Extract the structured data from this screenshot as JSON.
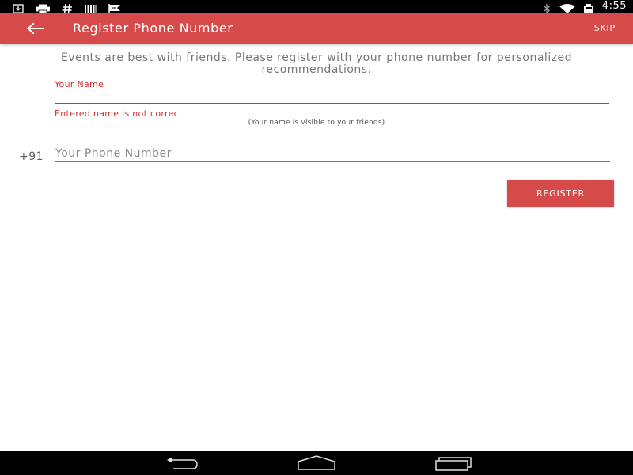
{
  "status_bar": {
    "time": "4:55",
    "left_icons": [
      "download-icon",
      "print-icon",
      "hash-icon",
      "barcode-icon",
      "flag-icon"
    ],
    "right_icons": [
      "bluetooth-icon",
      "wifi-icon",
      "battery-icon"
    ]
  },
  "app_bar": {
    "title": "Register Phone Number",
    "skip_label": "SKIP",
    "back_icon": "arrow-left-icon",
    "color": "#d64a4a"
  },
  "intro": {
    "text": "Events are best with friends. Please register with your phone number for personalized recommendations."
  },
  "name_field": {
    "label": "Your Name",
    "value": "",
    "error": "Entered name is not correct",
    "hint": "(Your name is visible to your friends)",
    "error_color": "#d32f2f"
  },
  "phone_field": {
    "country_code": "+91",
    "placeholder": "Your Phone Number",
    "value": ""
  },
  "register_button": {
    "label": "REGISTER"
  },
  "nav_bar": {
    "buttons": [
      "back-nav-icon",
      "home-nav-icon",
      "recents-nav-icon"
    ]
  }
}
